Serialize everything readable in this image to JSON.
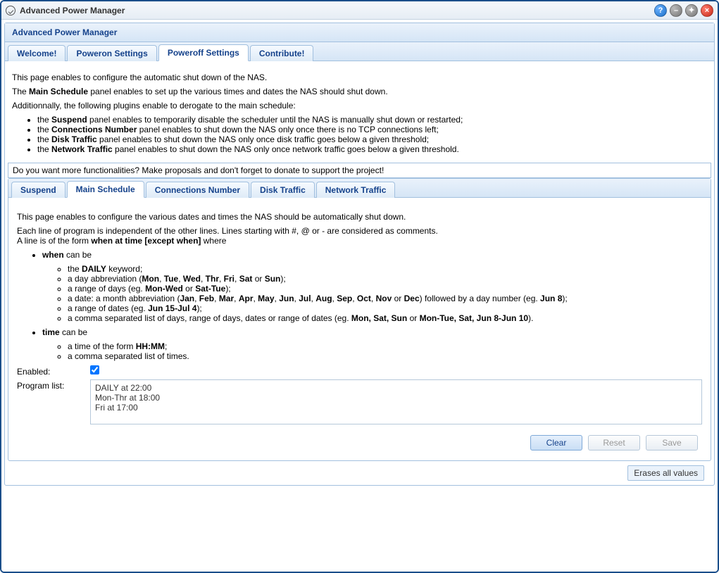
{
  "window": {
    "title": "Advanced Power Manager"
  },
  "panel": {
    "header": "Advanced Power Manager"
  },
  "mainTabs": [
    {
      "label": "Welcome!"
    },
    {
      "label": "Poweron Settings"
    },
    {
      "label": "Poweroff Settings"
    },
    {
      "label": "Contribute!"
    }
  ],
  "intro": {
    "p1": "This page enables to configure the automatic shut down of the NAS.",
    "p2_pre": "The ",
    "p2_bold": "Main Schedule",
    "p2_post": " panel enables to set up the various times and dates the NAS should shut down.",
    "p3": "Additionnally, the following plugins enable to derogate to the main schedule:",
    "bullets": {
      "suspend_pre": "the ",
      "suspend_b": "Suspend",
      "suspend_post": " panel enables to temporarily disable the scheduler until the NAS is manually shut down or restarted;",
      "conn_pre": "the ",
      "conn_b": "Connections Number",
      "conn_post": " panel enables to shut down the NAS only once there is no TCP connections left;",
      "disk_pre": "the ",
      "disk_b": "Disk Traffic",
      "disk_post": " panel enables to shut down the NAS only once disk traffic goes below a given threshold;",
      "net_pre": "the ",
      "net_b": "Network Traffic",
      "net_post": " panel enables to shut down the NAS only once network traffic goes below a given threshold."
    }
  },
  "donate": "Do you want more functionalities? Make proposals and don't forget to donate to support the project!",
  "subTabs": [
    {
      "label": "Suspend"
    },
    {
      "label": "Main Schedule"
    },
    {
      "label": "Connections Number"
    },
    {
      "label": "Disk Traffic"
    },
    {
      "label": "Network Traffic"
    }
  ],
  "schedule": {
    "p1": "This page enables to configure the various dates and times the NAS should be automatically shut down.",
    "p2_a": "Each line of program is independent of the other lines. Lines starting with #, @ or - are considered as comments.",
    "p2_b_pre": "A line is of the form ",
    "p2_b_bold": "when at time [except when]",
    "p2_b_post": " where",
    "when_label": "when",
    "when_canbe": " can be",
    "when_daily_pre": "the ",
    "when_daily_b": "DAILY",
    "when_daily_post": " keyword;",
    "when_abbr_pre": "a day abbreviation (",
    "days": [
      "Mon",
      "Tue",
      "Wed",
      "Thr",
      "Fri",
      "Sat",
      "Sun"
    ],
    "when_abbr_post": ");",
    "when_range_pre": "a range of days (eg. ",
    "when_range_b1": "Mon-Wed",
    "when_range_or": " or ",
    "when_range_b2": "Sat-Tue",
    "when_range_post": ");",
    "when_date_pre": "a date: a month abbreviation (",
    "months": [
      "Jan",
      "Feb",
      "Mar",
      "Apr",
      "May",
      "Jun",
      "Jul",
      "Aug",
      "Sep",
      "Oct",
      "Nov",
      "Dec"
    ],
    "when_date_mid": ") followed by a day number (eg. ",
    "when_date_b": "Jun 8",
    "when_date_post": ");",
    "when_daterange_pre": "a range of dates (eg. ",
    "when_daterange_b": "Jun 15-Jul 4",
    "when_daterange_post": ");",
    "when_list_pre": "a comma separated list of days, range of days, dates or range of dates (eg. ",
    "when_list_b1": "Mon, Sat, Sun",
    "when_list_or": " or ",
    "when_list_b2": "Mon-Tue, Sat, Jun 8-Jun 10",
    "when_list_post": ").",
    "time_label": "time",
    "time_canbe": " can be",
    "time_form_pre": "a time of the form ",
    "time_form_b": "HH:MM",
    "time_form_post": ";",
    "time_list": "a comma separated list of times."
  },
  "form": {
    "enabled_label": "Enabled:",
    "enabled_checked": true,
    "program_label": "Program list:",
    "program_value": "DAILY at 22:00\nMon-Thr at 18:00\nFri at 17:00"
  },
  "buttons": {
    "clear": "Clear",
    "reset": "Reset",
    "save": "Save"
  },
  "tooltip": "Erases all values"
}
